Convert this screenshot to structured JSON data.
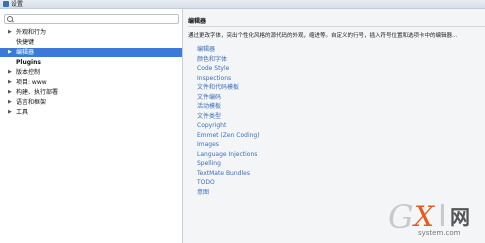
{
  "window": {
    "title": "设置"
  },
  "search": {
    "placeholder": "",
    "value": ""
  },
  "tree": [
    {
      "label": "外观和行为",
      "arrow": "▶",
      "selected": false,
      "bold": false
    },
    {
      "label": "快捷键",
      "arrow": "",
      "selected": false,
      "bold": false
    },
    {
      "label": "编辑器",
      "arrow": "▶",
      "selected": true,
      "bold": false
    },
    {
      "label": "Plugins",
      "arrow": "",
      "selected": false,
      "bold": true
    },
    {
      "label": "版本控制",
      "arrow": "▶",
      "selected": false,
      "bold": false
    },
    {
      "label": "项目: www",
      "arrow": "▶",
      "selected": false,
      "bold": false
    },
    {
      "label": "构建、执行部署",
      "arrow": "▶",
      "selected": false,
      "bold": false
    },
    {
      "label": "语言和框架",
      "arrow": "▶",
      "selected": false,
      "bold": false
    },
    {
      "label": "工具",
      "arrow": "▶",
      "selected": false,
      "bold": false
    }
  ],
  "panel": {
    "title": "编辑器",
    "description": "通过更改字体，突出个性化风格的源代码的外观，缩进等。自定义的行号，插入符号位置和选项卡中的编辑器…",
    "links": [
      "编辑器",
      "颜色和字体",
      "Code Style",
      "Inspections",
      "文件和代码模板",
      "文件编码",
      "活动模板",
      "文件类型",
      "Copyright",
      "Emmet (Zen Coding)",
      "Images",
      "Language Injections",
      "Spelling",
      "TextMate Bundles",
      "TODO",
      "意图"
    ]
  },
  "watermark": {
    "g": "G",
    "x": "X",
    "i": "I",
    "cn": "网",
    "sub": "system.com"
  }
}
